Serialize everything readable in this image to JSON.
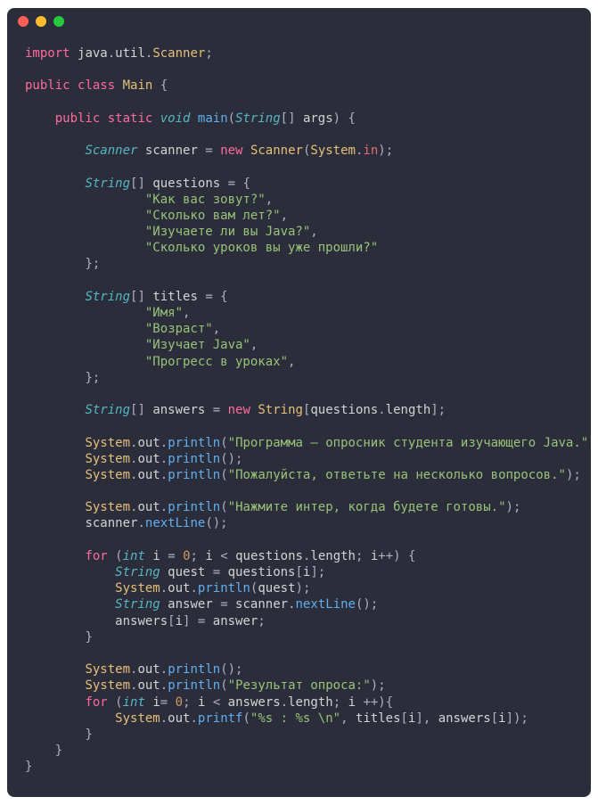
{
  "window": {
    "type": "code-editor"
  },
  "code": {
    "line1_import": "import",
    "line1_pkg": "java",
    "line1_util": "util",
    "line1_scanner": "Scanner",
    "line3_public": "public",
    "line3_class": "class",
    "line3_main": "Main",
    "line5_public": "public",
    "line5_static": "static",
    "line5_void": "void",
    "line5_main": "main",
    "line5_string": "String",
    "line5_args": "args",
    "line7_scanner_type": "Scanner",
    "line7_scanner_var": "scanner",
    "line7_new": "new",
    "line7_scanner_ctor": "Scanner",
    "line7_system": "System",
    "line7_in": "in",
    "line9_string": "String",
    "line9_questions": "questions",
    "line10_q1": "\"Как вас зовут?\"",
    "line11_q2": "\"Сколько вам лет?\"",
    "line12_q3": "\"Изучаете ли вы Java?\"",
    "line13_q4": "\"Сколько уроков вы уже прошли?\"",
    "line16_string": "String",
    "line16_titles": "titles",
    "line17_t1": "\"Имя\"",
    "line18_t2": "\"Возраст\"",
    "line19_t3": "\"Изучает Java\"",
    "line20_t4": "\"Прогресс в уроках\"",
    "line23_string": "String",
    "line23_answers": "answers",
    "line23_new": "new",
    "line23_string2": "String",
    "line23_questions": "questions",
    "line23_length": "length",
    "line25_system": "System",
    "line25_out": "out",
    "line25_println": "println",
    "line25_str": "\"Программа – опросник студента изучающего Java.\"",
    "line26_system": "System",
    "line26_out": "out",
    "line26_println": "println",
    "line27_system": "System",
    "line27_out": "out",
    "line27_println": "println",
    "line27_str": "\"Пожалуйста, ответьте на несколько вопросов.\"",
    "line29_system": "System",
    "line29_out": "out",
    "line29_println": "println",
    "line29_str": "\"Нажмите интер, когда будете готовы.\"",
    "line30_scanner": "scanner",
    "line30_nextline": "nextLine",
    "line32_for": "for",
    "line32_int": "int",
    "line32_i": "i",
    "line32_zero": "0",
    "line32_i2": "i",
    "line32_questions": "questions",
    "line32_length": "length",
    "line32_i3": "i",
    "line33_string": "String",
    "line33_quest": "quest",
    "line33_questions": "questions",
    "line33_i": "i",
    "line34_system": "System",
    "line34_out": "out",
    "line34_println": "println",
    "line34_quest": "quest",
    "line35_string": "String",
    "line35_answer": "answer",
    "line35_scanner": "scanner",
    "line35_nextline": "nextLine",
    "line36_answers": "answers",
    "line36_i": "i",
    "line36_answer": "answer",
    "line39_system": "System",
    "line39_out": "out",
    "line39_println": "println",
    "line40_system": "System",
    "line40_out": "out",
    "line40_println": "println",
    "line40_str": "\"Результат опроса:\"",
    "line41_for": "for",
    "line41_int": "int",
    "line41_i": "i",
    "line41_zero": "0",
    "line41_i2": "i",
    "line41_answers": "answers",
    "line41_length": "length",
    "line41_i3": "i",
    "line42_system": "System",
    "line42_out": "out",
    "line42_printf": "printf",
    "line42_str": "\"%s : %s \\n\"",
    "line42_titles": "titles",
    "line42_i": "i",
    "line42_answers": "answers",
    "line42_i2": "i"
  }
}
